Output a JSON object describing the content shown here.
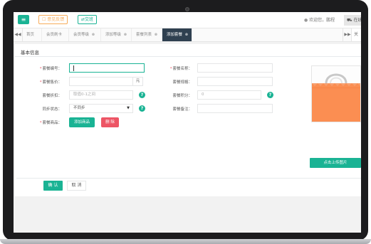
{
  "topbar": {
    "menu_icon": "≡",
    "feedback_label": "☐ 意见反馈",
    "shift_label": "⇄交班",
    "welcome_text": "欢迎您，鹏程",
    "exit_label": "在线"
  },
  "tabs": {
    "items": [
      {
        "label": "首页",
        "closable": false
      },
      {
        "label": "会员刷卡",
        "closable": false
      },
      {
        "label": "会员等级",
        "closable": true
      },
      {
        "label": "添加等级",
        "closable": true
      },
      {
        "label": "套餐列表",
        "closable": true
      },
      {
        "label": "添加套餐",
        "closable": true,
        "active": true
      }
    ],
    "more_label": "关"
  },
  "form": {
    "section_title": "基本信息",
    "fields": {
      "code_label": "套餐编号：",
      "name_label": "套餐名称：",
      "price_label": "套餐售价：",
      "price_unit": "元",
      "spec_label": "套餐规格：",
      "discount_label": "套餐折扣：",
      "discount_placeholder": "取值0-1之间",
      "points_label": "套餐积分：",
      "points_placeholder": "0",
      "sync_label": "同步状态：",
      "sync_value": "不同步",
      "remark_label": "套餐备注：",
      "goods_label": "套餐商品："
    },
    "add_goods_label": "添加商品",
    "delete_label": "删 除",
    "upload_label": "点击上传图片",
    "confirm_label": "确 认",
    "cancel_label": "取 消"
  },
  "colors": {
    "accent": "#1ab394",
    "danger": "#ed5565",
    "warning": "#f8ac59",
    "dark_tab": "#2f4050",
    "bag_orange": "#fb8e52"
  }
}
